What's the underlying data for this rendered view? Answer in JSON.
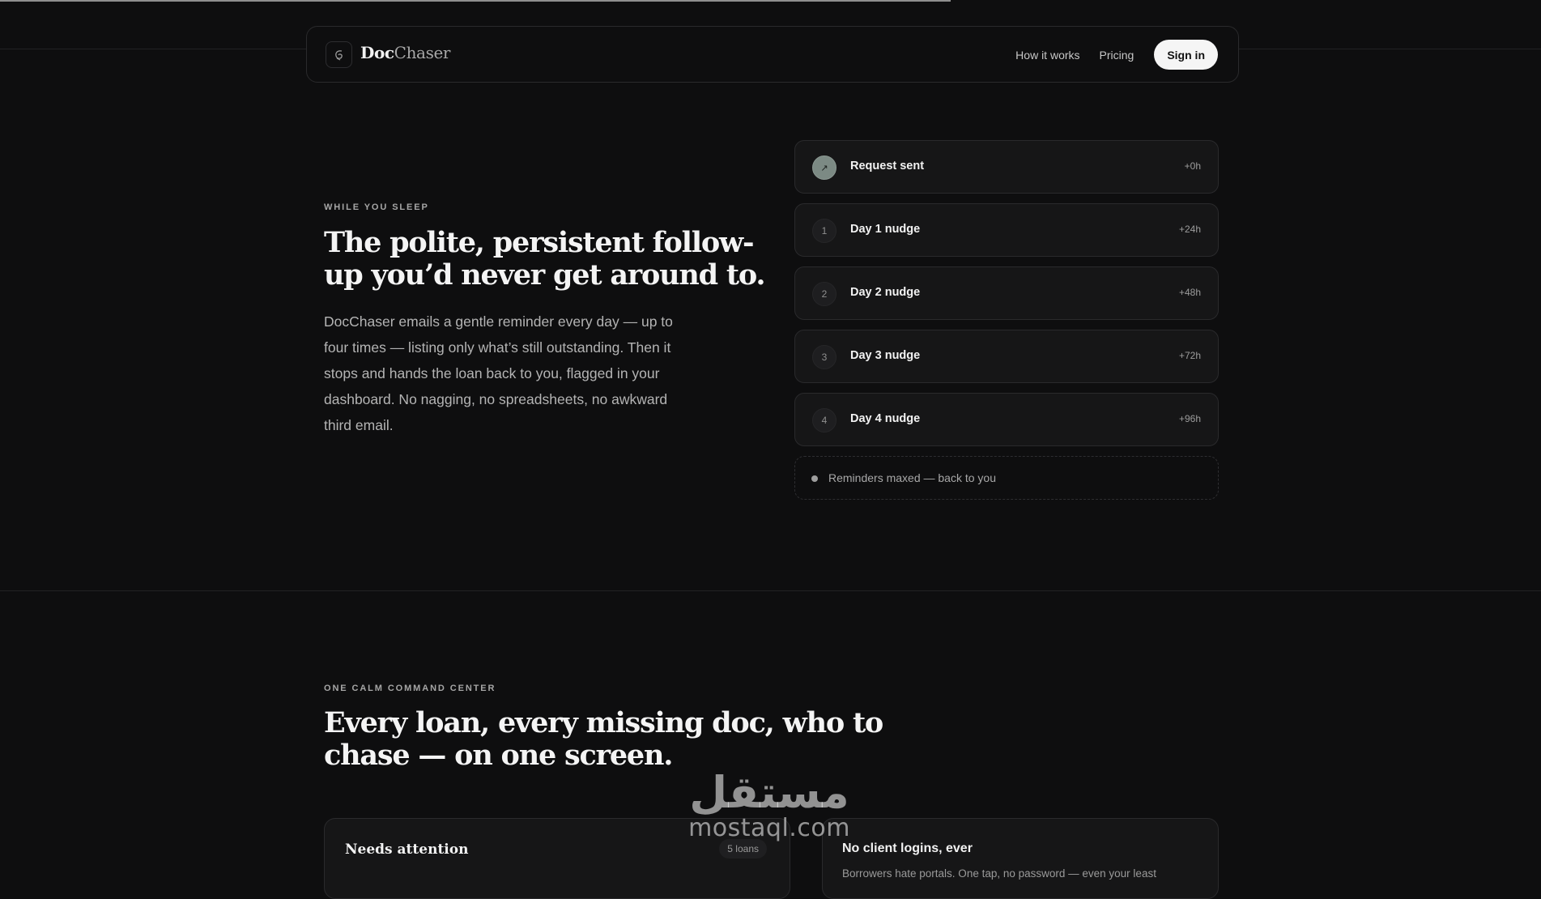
{
  "nav": {
    "logo_icon": "document-swirl-icon",
    "logo_primary": "Doc",
    "logo_secondary": "Chaser",
    "links": [
      "How it works",
      "Pricing"
    ],
    "cta": "Sign in"
  },
  "hero": {
    "eyebrow": "WHILE YOU SLEEP",
    "title": "The polite, persistent follow-up you’d never get around to.",
    "body": "DocChaser emails a gentle reminder every day — up to four times — listing only what’s still outstanding. Then it stops and hands the loan back to you, flagged in your dashboard. No nagging, no spreadsheets, no awkward third email."
  },
  "timeline": {
    "steps": [
      {
        "marker": "↗",
        "label": "Request sent",
        "time": "+0h"
      },
      {
        "marker": "1",
        "label": "Day 1 nudge",
        "time": "+24h"
      },
      {
        "marker": "2",
        "label": "Day 2 nudge",
        "time": "+48h"
      },
      {
        "marker": "3",
        "label": "Day 3 nudge",
        "time": "+72h"
      },
      {
        "marker": "4",
        "label": "Day 4 nudge",
        "time": "+96h"
      }
    ],
    "end_label": "Reminders maxed — back to you"
  },
  "section2": {
    "eyebrow": "ONE CALM COMMAND CENTER",
    "title": "Every loan, every missing doc, who to chase — on one screen."
  },
  "cards": {
    "attention_title": "Needs attention",
    "attention_badge": "5 loans",
    "logins_title": "No client logins, ever",
    "logins_sub": "Borrowers hate portals. One tap, no password — even your least"
  },
  "watermark": {
    "arabic": "مستقل",
    "latin": "mostaql.com"
  }
}
